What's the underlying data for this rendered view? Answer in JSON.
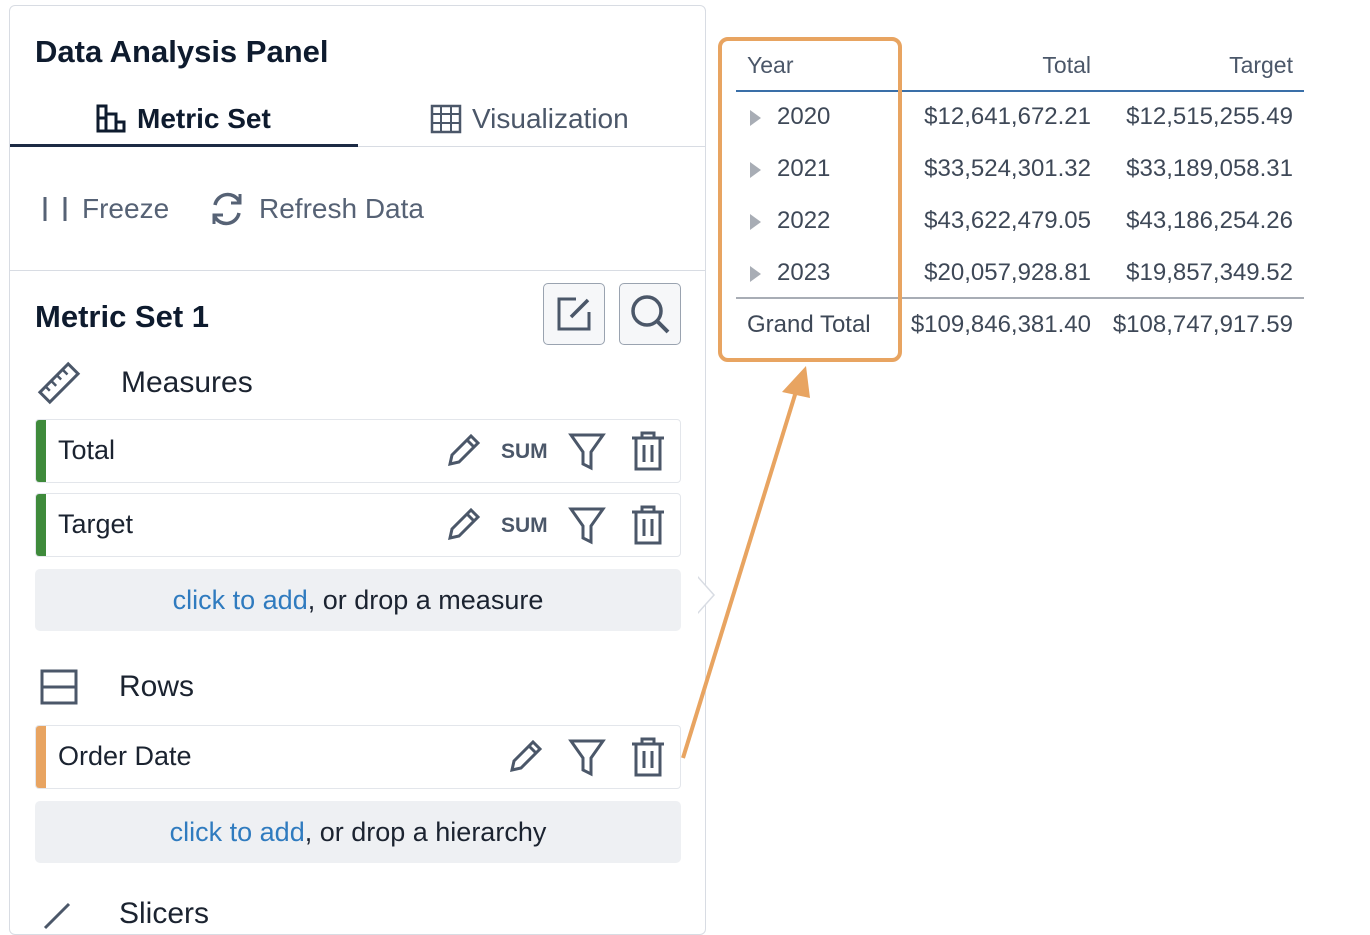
{
  "panel": {
    "title": "Data Analysis Panel",
    "tabs": [
      {
        "label": "Metric Set",
        "active": true,
        "icon": "metric-set-icon"
      },
      {
        "label": "Visualization",
        "active": false,
        "icon": "grid-table-icon"
      }
    ],
    "toolbar": {
      "freeze_label": "Freeze",
      "refresh_label": "Refresh Data"
    },
    "metric_set": {
      "title": "Metric Set 1",
      "measures": {
        "label": "Measures",
        "items": [
          {
            "name": "Total",
            "aggregation": "SUM",
            "color": "#3e8a3b"
          },
          {
            "name": "Target",
            "aggregation": "SUM",
            "color": "#3e8a3b"
          }
        ],
        "drop_link": "click to add",
        "drop_rest": ", or drop a measure"
      },
      "rows": {
        "label": "Rows",
        "items": [
          {
            "name": "Order Date",
            "color": "#e8a461"
          }
        ],
        "drop_link": "click to add",
        "drop_rest": ", or drop a hierarchy"
      },
      "slicers": {
        "label": "Slicers"
      }
    }
  },
  "table": {
    "columns": [
      "Year",
      "Total",
      "Target"
    ],
    "rows": [
      {
        "year": "2020",
        "total": "$12,641,672.21",
        "target": "$12,515,255.49"
      },
      {
        "year": "2021",
        "total": "$33,524,301.32",
        "target": "$33,189,058.31"
      },
      {
        "year": "2022",
        "total": "$43,622,479.05",
        "target": "$43,186,254.26"
      },
      {
        "year": "2023",
        "total": "$20,057,928.81",
        "target": "$19,857,349.52"
      }
    ],
    "grand_total": {
      "label": "Grand Total",
      "total": "$109,846,381.40",
      "target": "$108,747,917.59"
    }
  },
  "colors": {
    "accent": "#2f7bbf",
    "highlight": "#e8a461",
    "measure_bar": "#3e8a3b",
    "row_bar": "#e8a461"
  }
}
